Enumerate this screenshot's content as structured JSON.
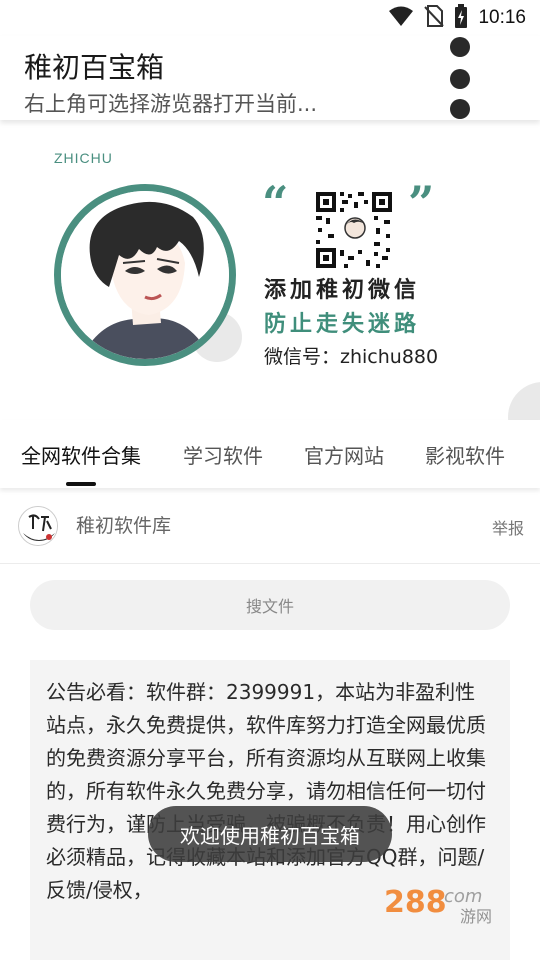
{
  "status_bar": {
    "time": "10:16",
    "icons": [
      "wifi-icon",
      "no-sim-icon",
      "battery-charging-icon"
    ]
  },
  "app_bar": {
    "title": "稚初百宝箱",
    "subtitle": "右上角可选择游览器打开当前...",
    "menu_icon": "more-vert-icon"
  },
  "banner": {
    "brand": "ZHICHU",
    "open_quote": "“",
    "close_quote": "”",
    "line1": "添加稚初微信",
    "line2": "防止走失迷路",
    "wechat_id": "微信号：zhichu880",
    "accent_color": "#4a8f80"
  },
  "tabs": [
    {
      "label": "全网软件合集",
      "active": true
    },
    {
      "label": "学习软件",
      "active": false
    },
    {
      "label": "官方网站",
      "active": false
    },
    {
      "label": "影视软件",
      "active": false
    }
  ],
  "source": {
    "logo_icon": "zhichu-logo-icon",
    "name": "稚初软件库",
    "report": "举报"
  },
  "search": {
    "placeholder": "搜文件"
  },
  "notice": {
    "text": "公告必看：软件群：2399991，本站为非盈利性站点，永久免费提供，软件库努力打造全网最优质的免费资源分享平台，所有资源均从互联网上收集的，所有软件永久免费分享，请勿相信任何一切付费行为，谨防上当受骗，被骗概不负责！用心创作必须精品，记得收藏本站和添加官方QQ群，问题/反馈/侵权，"
  },
  "toast": {
    "text": "欢迎使用稚初百宝箱"
  },
  "watermark": {
    "text": "288.com 游网"
  }
}
